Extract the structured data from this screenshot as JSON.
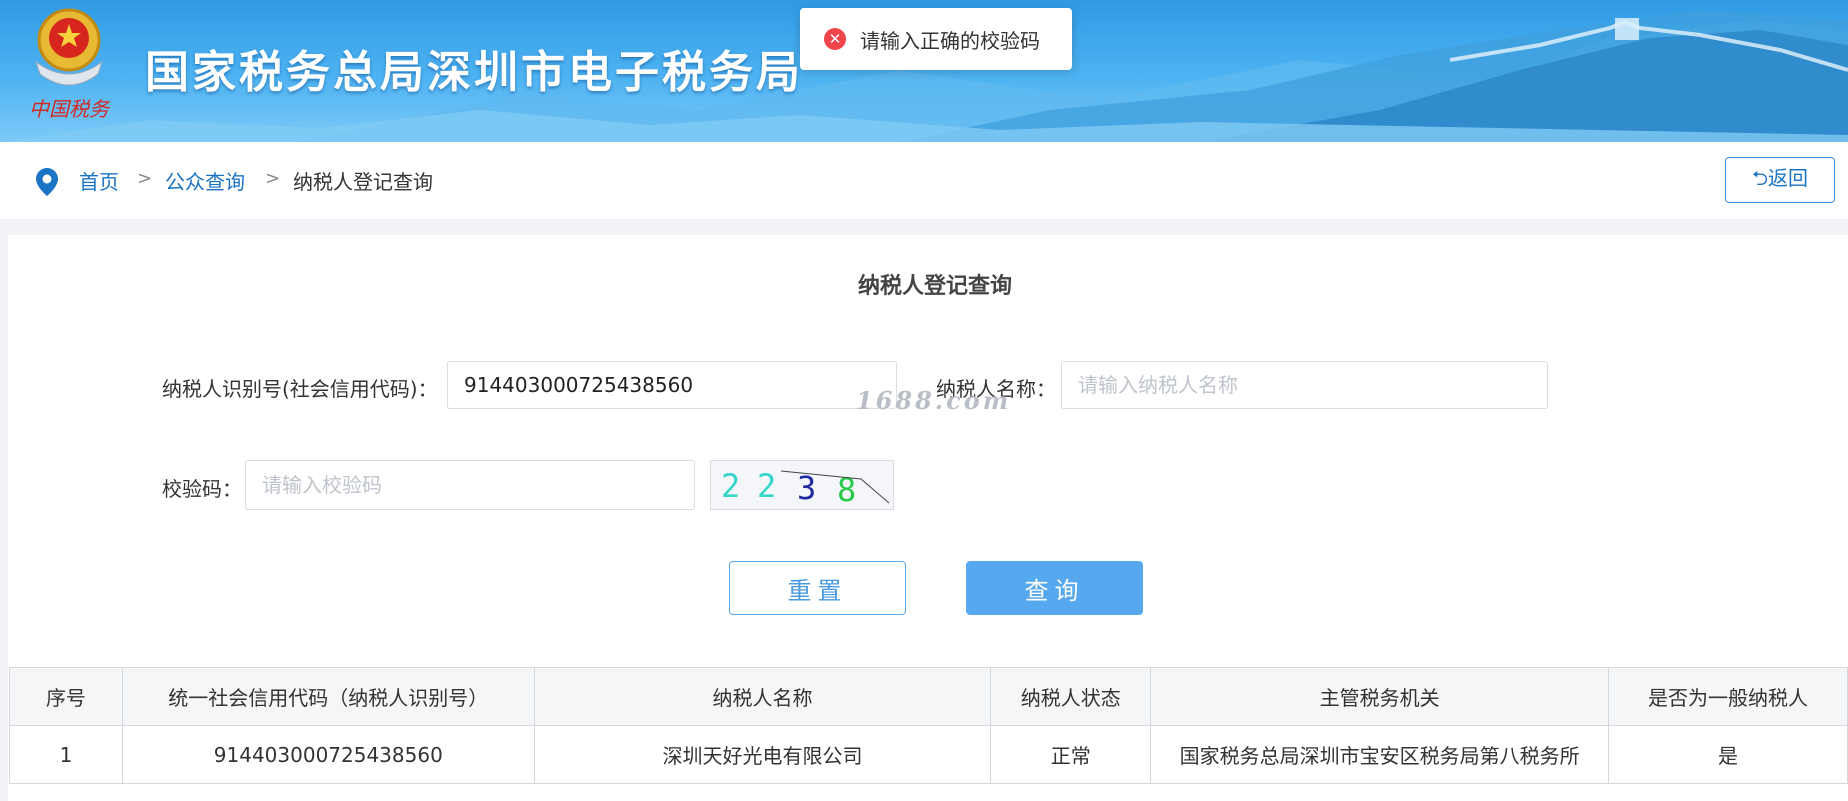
{
  "banner": {
    "title": "国家税务总局深圳市电子税务局",
    "emblem_text": "中国税务"
  },
  "toast": {
    "icon": "close-circle-icon",
    "message": "请输入正确的校验码"
  },
  "breadcrumb": {
    "home": "首页",
    "sep": ">",
    "level2": "公众查询",
    "current": "纳税人登记查询"
  },
  "back_button": {
    "icon": "back-arrow-icon",
    "label": "⮌返回"
  },
  "form": {
    "title": "纳税人登记查询",
    "tin_label": "纳税人识别号(社会信用代码)：",
    "tin_value": "914403000725438560",
    "name_label": "纳税人名称：",
    "name_placeholder": "请输入纳税人名称",
    "captcha_label": "校验码：",
    "captcha_placeholder": "请输入校验码",
    "captcha_image_text": "2238",
    "watermark": "1688.com",
    "reset_label": "重置",
    "query_label": "查询"
  },
  "table": {
    "headers": [
      "序号",
      "统一社会信用代码（纳税人识别号）",
      "纳税人名称",
      "纳税人状态",
      "主管税务机关",
      "是否为一般纳税人"
    ],
    "rows": [
      [
        "1",
        "914403000725438560",
        "深圳天好光电有限公司",
        "正常",
        "国家税务总局深圳市宝安区税务局第八税务所",
        "是"
      ]
    ]
  },
  "colors": {
    "link": "#1a73c4",
    "primary_button": "#57a9ef",
    "error": "#f0464b"
  }
}
